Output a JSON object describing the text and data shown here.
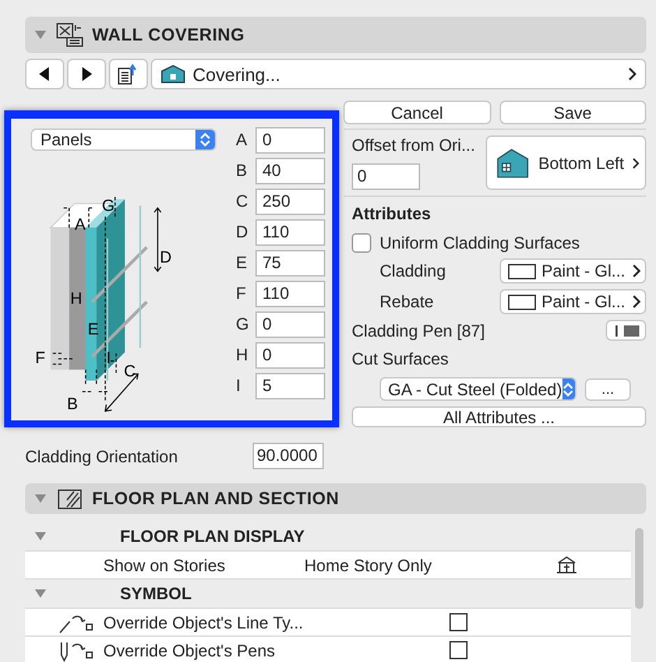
{
  "section": {
    "title": "WALL COVERING",
    "expanded": true
  },
  "nav": {
    "current": "Covering..."
  },
  "actions": [
    "Cancel",
    "Save"
  ],
  "panel": {
    "type_select": "Panels",
    "diagram_labels": [
      "A",
      "G",
      "D",
      "H",
      "E",
      "F",
      "B",
      "C",
      "I"
    ],
    "params": [
      {
        "label": "A",
        "value": "0"
      },
      {
        "label": "B",
        "value": "40"
      },
      {
        "label": "C",
        "value": "250"
      },
      {
        "label": "D",
        "value": "110"
      },
      {
        "label": "E",
        "value": "75"
      },
      {
        "label": "F",
        "value": "110"
      },
      {
        "label": "G",
        "value": "0"
      },
      {
        "label": "H",
        "value": "0"
      },
      {
        "label": "I",
        "value": "5"
      }
    ]
  },
  "offset": {
    "label": "Offset from Ori...",
    "value": "0",
    "anchor": "Bottom Left"
  },
  "attributes": {
    "title": "Attributes",
    "uniform": {
      "label": "Uniform Cladding Surfaces",
      "checked": false
    },
    "surfaces": [
      {
        "label": "Cladding",
        "value": "Paint - Gl..."
      },
      {
        "label": "Rebate",
        "value": "Paint - Gl..."
      }
    ],
    "pen_label": "Cladding Pen [87]",
    "cut_label": "Cut Surfaces",
    "cut_value": "GA - Cut Steel (Folded)",
    "more": "...",
    "all": "All Attributes ..."
  },
  "orientation": {
    "label": "Cladding Orientation",
    "value": "90.0000"
  },
  "section2": {
    "title": "FLOOR PLAN AND SECTION",
    "expanded": true
  },
  "table": {
    "groups": [
      {
        "title": "FLOOR PLAN DISPLAY",
        "expanded": true,
        "rows": [
          {
            "kind": "value",
            "label": "Show on Stories",
            "value": "Home Story Only"
          }
        ]
      },
      {
        "title": "SYMBOL",
        "expanded": true,
        "rows": [
          {
            "kind": "check",
            "label": "Override Object's Line Ty...",
            "checked": false
          },
          {
            "kind": "check",
            "label": "Override Object's Pens",
            "checked": false
          }
        ]
      }
    ]
  }
}
